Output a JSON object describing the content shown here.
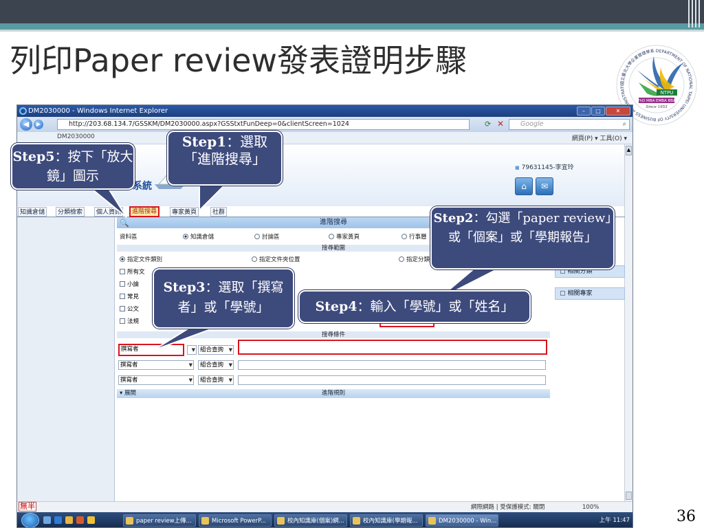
{
  "slide": {
    "title": "列印Paper review發表證明步驟",
    "page_number": "36",
    "logo_text": {
      "ring": "國立臺北大學企業管理學系 DEPARTMENT OF NATIONAL TAIPEI UNIVERSITY OF BUSINESS ADMINISTRATION",
      "center": "NTPU",
      "programs": "PhD MBA EMBA BBA",
      "since": "Since 1953"
    }
  },
  "browser": {
    "window_title": "DM2030000 - Windows Internet Explorer",
    "address": "http://203.68.134.7/GSSKM/DM2030000.aspx?GSStxtFunDeep=0&clientScreen=1024",
    "search_placeholder": "Google",
    "tab_label": "DM2030000",
    "toolbar_right": "網頁(P) ▾ 工具(O) ▾"
  },
  "site": {
    "system_label": "系統",
    "user": "79631145-李宜玲",
    "nav_tabs": [
      "知識倉儲",
      "分類檢索",
      "個人資訊",
      "進階搜尋",
      "專家黃頁",
      "社群"
    ],
    "search_panel_title": "進階搜尋",
    "data_area_label": "資料區",
    "data_area_options": [
      "知識倉儲",
      "討論區",
      "專家黃頁",
      "行事曆"
    ],
    "search_scope_header": "搜尋範圍",
    "scope_options": [
      "指定文件類別",
      "指定文件夾位置",
      "指定分類架構"
    ],
    "doc_categories": [
      "所有文",
      "小論",
      "常見",
      "公文",
      "法規"
    ],
    "search_conditions_header": "搜尋條件",
    "condition_field_value": "撰寫者",
    "condition_op_value": "組合查詢",
    "rows_count_label": "",
    "footer_expand": "展開",
    "footer_rules": "進階規則",
    "right_panel": [
      "相關分類",
      "相關專家"
    ]
  },
  "status": {
    "ime_1": "無",
    "ime_2": "半",
    "zone": "網際網路 | 受保護模式: 關閉",
    "zoom": "100%"
  },
  "taskbar": {
    "items": [
      "paper review上傳...",
      "Microsoft PowerP...",
      "校內知識庫(個案)網...",
      "校內知識庫(學期報...",
      "DM2030000 - Win..."
    ],
    "clock": "上午 11:47"
  },
  "callouts": {
    "step1": {
      "label": "Step1",
      "text": "：選取「進階搜尋」"
    },
    "step2": {
      "label": "Step2",
      "text": "：勾選「paper review」或「個案」或「學期報告」"
    },
    "step3": {
      "label": "Step3",
      "text": "：選取「撰寫者」或「學號」"
    },
    "step4": {
      "label": "Step4",
      "text": "：輸入「學號」或「姓名」"
    },
    "step5": {
      "label": "Step5",
      "text": "：按下「放大鏡」圖示"
    }
  },
  "colors": {
    "callout_bg": "#3d4a7c",
    "highlight_red": "#d8141c",
    "topbar": "#3c4450",
    "teal": "#5a9aa2"
  }
}
